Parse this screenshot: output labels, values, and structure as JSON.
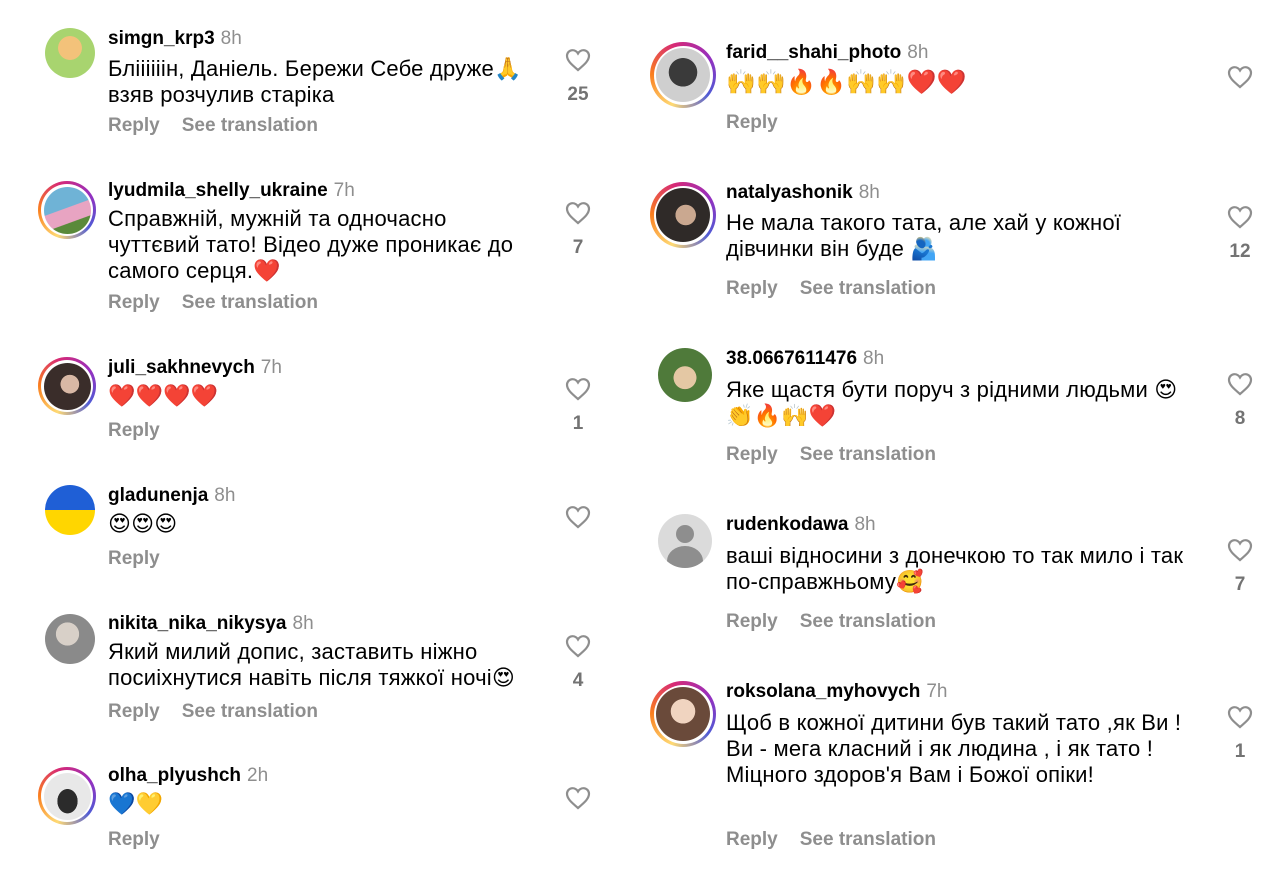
{
  "left_column": [
    {
      "user": "simgn_krp3",
      "time": "8h",
      "text": "Бліііііін, Даніель.  Бережи Себе друже🙏 взяв розчулив старіка",
      "reply": "Reply",
      "translate": "See translation",
      "likes": "25",
      "avatar_colors": [
        "#a8d46f",
        "#f3c27a"
      ]
    },
    {
      "user": "lyudmila_shelly_ukraine",
      "time": "7h",
      "text": "Справжній, мужній та одночасно чуттєвий тато! Відео дуже проникає до самого серця.❤️",
      "reply": "Reply",
      "translate": "See translation",
      "likes": "7",
      "avatar_colors": [
        "#6fb3d6",
        "#e8a4c2"
      ]
    },
    {
      "user": "juli_sakhnevych",
      "time": "7h",
      "text": "❤️❤️❤️❤️",
      "reply": "Reply",
      "translate": "",
      "likes": "1",
      "avatar_colors": [
        "#3a2d2a",
        "#d9b8a5"
      ]
    },
    {
      "user": "gladunenja",
      "time": "8h",
      "text": "😍😍😍",
      "reply": "Reply",
      "translate": "",
      "likes": "",
      "avatar_colors": [
        "#1f5fd6",
        "#ffd600"
      ]
    },
    {
      "user": "nikita_nika_nikysya",
      "time": "8h",
      "text": "Який милий допис, заставить ніжно посиіхнутися навіть після тяжкої ночі😍",
      "reply": "Reply",
      "translate": "See translation",
      "likes": "4",
      "avatar_colors": [
        "#8a8a8a",
        "#d8d0c8"
      ]
    },
    {
      "user": "olha_plyushch",
      "time": "2h",
      "text": "💙💛",
      "reply": "Reply",
      "translate": "",
      "likes": "",
      "avatar_colors": [
        "#e8e8e8",
        "#2b2b2b"
      ]
    }
  ],
  "right_column": [
    {
      "user": "farid__shahi_photo",
      "time": "8h",
      "text": "🙌🙌🔥🔥🙌🙌❤️❤️",
      "reply": "Reply",
      "translate": "",
      "likes": "",
      "avatar_colors": [
        "#cfcfcf",
        "#3a3a3a"
      ]
    },
    {
      "user": "natalyashonik",
      "time": "8h",
      "text": "Не мала такого тата, але хай у кожної дівчинки він буде 🫂",
      "reply": "Reply",
      "translate": "See translation",
      "likes": "12",
      "avatar_colors": [
        "#2f2a28",
        "#caa890"
      ]
    },
    {
      "user": "38.0667611476",
      "time": "8h",
      "text": "Яке щастя бути поруч з рідними людьми 😍👏🔥🙌❤️",
      "reply": "Reply",
      "translate": "See translation",
      "likes": "8",
      "avatar_colors": [
        "#4f7a3a",
        "#e4c8a4"
      ]
    },
    {
      "user": "rudenkodawa",
      "time": "8h",
      "text": "ваші відносини з донечкою то так мило і так по-справжньому🥰",
      "reply": "Reply",
      "translate": "See translation",
      "likes": "7",
      "avatar_colors": [
        "#dbdbdb",
        "#b0b0b0"
      ]
    },
    {
      "user": "roksolana_myhovych",
      "time": "7h",
      "text": "Щоб в кожної дитини був такий тато ,як Ви !Ви - мега класний і як людина , і як тато ! Міцного здоров'я Вам і Божої опіки!",
      "reply": "Reply",
      "translate": "See translation",
      "likes": "1",
      "avatar_colors": [
        "#6a4a3a",
        "#f0d4c0"
      ]
    }
  ],
  "icons": {
    "like": "heart-outline-icon",
    "default_avatar": "person-silhouette-icon"
  },
  "colors": {
    "secondary_text": "#8e8e8e",
    "count": "#737373",
    "story_ring": "#d62976"
  }
}
